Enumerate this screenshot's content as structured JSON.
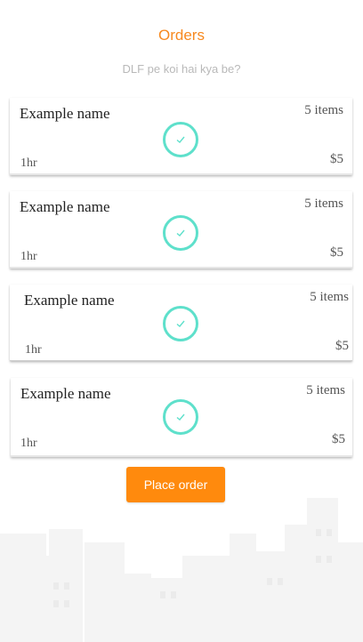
{
  "header": {
    "title": "Orders",
    "subtitle": "DLF pe koi hai kya be?"
  },
  "orders": [
    {
      "name": "Example name",
      "items": "5 items",
      "time": "1hr",
      "price": "$5",
      "status_icon": "check-circle-icon"
    },
    {
      "name": "Example name",
      "items": "5 items",
      "time": "1hr",
      "price": "$5",
      "status_icon": "check-circle-icon"
    },
    {
      "name": "Example name",
      "items": "5 items",
      "time": "1hr",
      "price": "$5",
      "status_icon": "check-circle-icon"
    },
    {
      "name": "Example name",
      "items": "5 items",
      "time": "1hr",
      "price": "$5",
      "status_icon": "check-circle-icon"
    }
  ],
  "actions": {
    "place_order_label": "Place order"
  },
  "colors": {
    "accent": "#f7891f",
    "button": "#ff8a0d",
    "check": "#5ee0cb",
    "subtitle": "#b9b9b9"
  },
  "background": {
    "image": "city-skyline-illustration"
  }
}
